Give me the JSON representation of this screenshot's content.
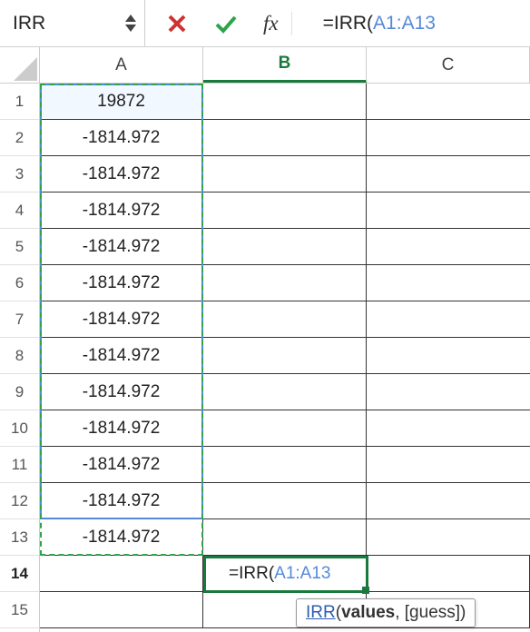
{
  "formula_bar": {
    "namebox": "IRR",
    "fx_label": "fx",
    "formula_prefix": "=IRR(",
    "formula_ref": "A1:A13"
  },
  "columns": {
    "a": "A",
    "b": "B",
    "c": "C"
  },
  "rows": [
    {
      "num": "1",
      "a": "19872"
    },
    {
      "num": "2",
      "a": "-1814.972"
    },
    {
      "num": "3",
      "a": "-1814.972"
    },
    {
      "num": "4",
      "a": "-1814.972"
    },
    {
      "num": "5",
      "a": "-1814.972"
    },
    {
      "num": "6",
      "a": "-1814.972"
    },
    {
      "num": "7",
      "a": "-1814.972"
    },
    {
      "num": "8",
      "a": "-1814.972"
    },
    {
      "num": "9",
      "a": "-1814.972"
    },
    {
      "num": "10",
      "a": "-1814.972"
    },
    {
      "num": "11",
      "a": "-1814.972"
    },
    {
      "num": "12",
      "a": "-1814.972"
    },
    {
      "num": "13",
      "a": "-1814.972"
    },
    {
      "num": "14",
      "a": ""
    },
    {
      "num": "15",
      "a": ""
    }
  ],
  "active_cell": {
    "prefix": "=IRR(",
    "ref": "A1:A13"
  },
  "tooltip": {
    "fn": "IRR",
    "open": "(",
    "arg1": "values",
    "sep": ", ",
    "arg2": "[guess]",
    "close": ")"
  }
}
